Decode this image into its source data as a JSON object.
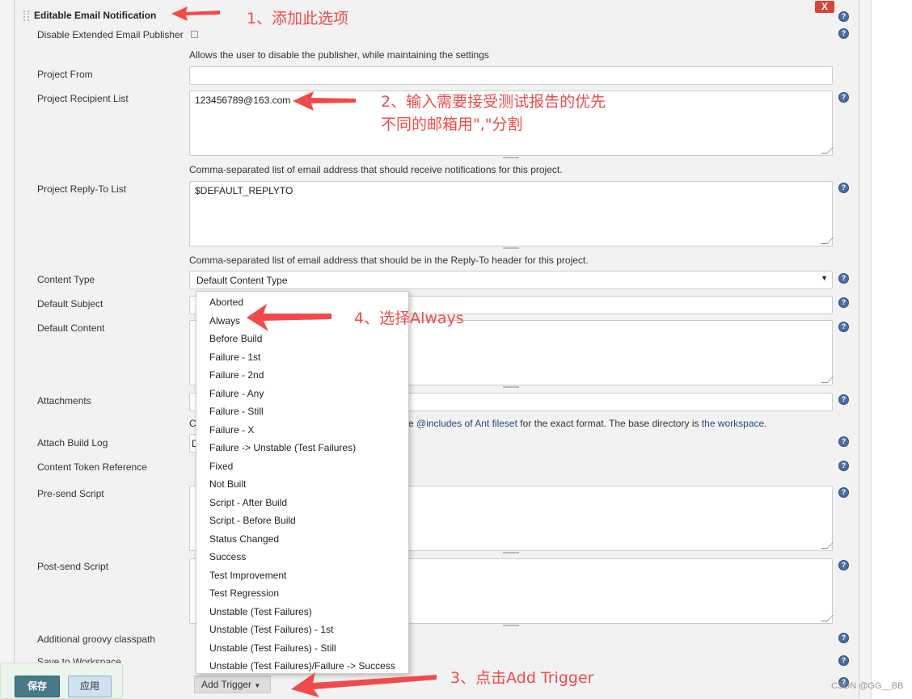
{
  "section": {
    "title": "Editable Email Notification",
    "close_label": "X"
  },
  "fields": {
    "disable_label": "Disable Extended Email Publisher",
    "disable_desc": "Allows the user to disable the publisher, while maintaining the settings",
    "project_from_label": "Project From",
    "project_from_value": "",
    "recipient_label": "Project Recipient List",
    "recipient_value": "123456789@163.com",
    "recipient_desc": "Comma-separated list of email address that should receive notifications for this project.",
    "replyto_label": "Project Reply-To List",
    "replyto_value": "$DEFAULT_REPLYTO",
    "replyto_desc": "Comma-separated list of email address that should be in the Reply-To header for this project.",
    "content_type_label": "Content Type",
    "content_type_value": "Default Content Type",
    "subject_label": "Default Subject",
    "content_label": "Default Content",
    "attachments_label": "Attachments",
    "attachments_desc_start": "C",
    "attachments_desc_mid": "e ",
    "attachments_link1": "@includes of Ant fileset",
    "attachments_desc_tail": " for the exact format. The base directory is ",
    "attachments_link2": "the workspace",
    "attachments_desc_end": ".",
    "build_log_label": "Attach Build Log",
    "build_log_value": "D",
    "token_label": "Content Token Reference",
    "presend_label": "Pre-send Script",
    "postsend_label": "Post-send Script",
    "groovy_label": "Additional groovy classpath",
    "workspace_label": "Save to Workspace",
    "add_trigger_label": "Add Trigger"
  },
  "trigger_options": [
    "Aborted",
    "Always",
    "Before Build",
    "Failure - 1st",
    "Failure - 2nd",
    "Failure - Any",
    "Failure - Still",
    "Failure - X",
    "Failure -> Unstable (Test Failures)",
    "Fixed",
    "Not Built",
    "Script - After Build",
    "Script - Before Build",
    "Status Changed",
    "Success",
    "Test Improvement",
    "Test Regression",
    "Unstable (Test Failures)",
    "Unstable (Test Failures) - 1st",
    "Unstable (Test Failures) - Still",
    "Unstable (Test Failures)/Failure -> Success"
  ],
  "save_bar": {
    "save": "保存",
    "apply": "应用"
  },
  "annotations": {
    "a1": "1、添加此选项",
    "a2_line1": "2、输入需要接受测试报告的优先",
    "a2_line2": "不同的邮箱用\",\"分割",
    "a3": "3、点击Add Trigger",
    "a4": "4、选择Always"
  },
  "watermark": "CSDN @GG__BB",
  "colors": {
    "annotation": "#f24a4a",
    "close": "#d9443a",
    "save": "#497a8a",
    "apply": "#cfe0f0"
  },
  "icons": {
    "help": "help-icon",
    "close": "close-icon",
    "drag": "drag-handle-icon",
    "caret": "caret-down-icon"
  }
}
